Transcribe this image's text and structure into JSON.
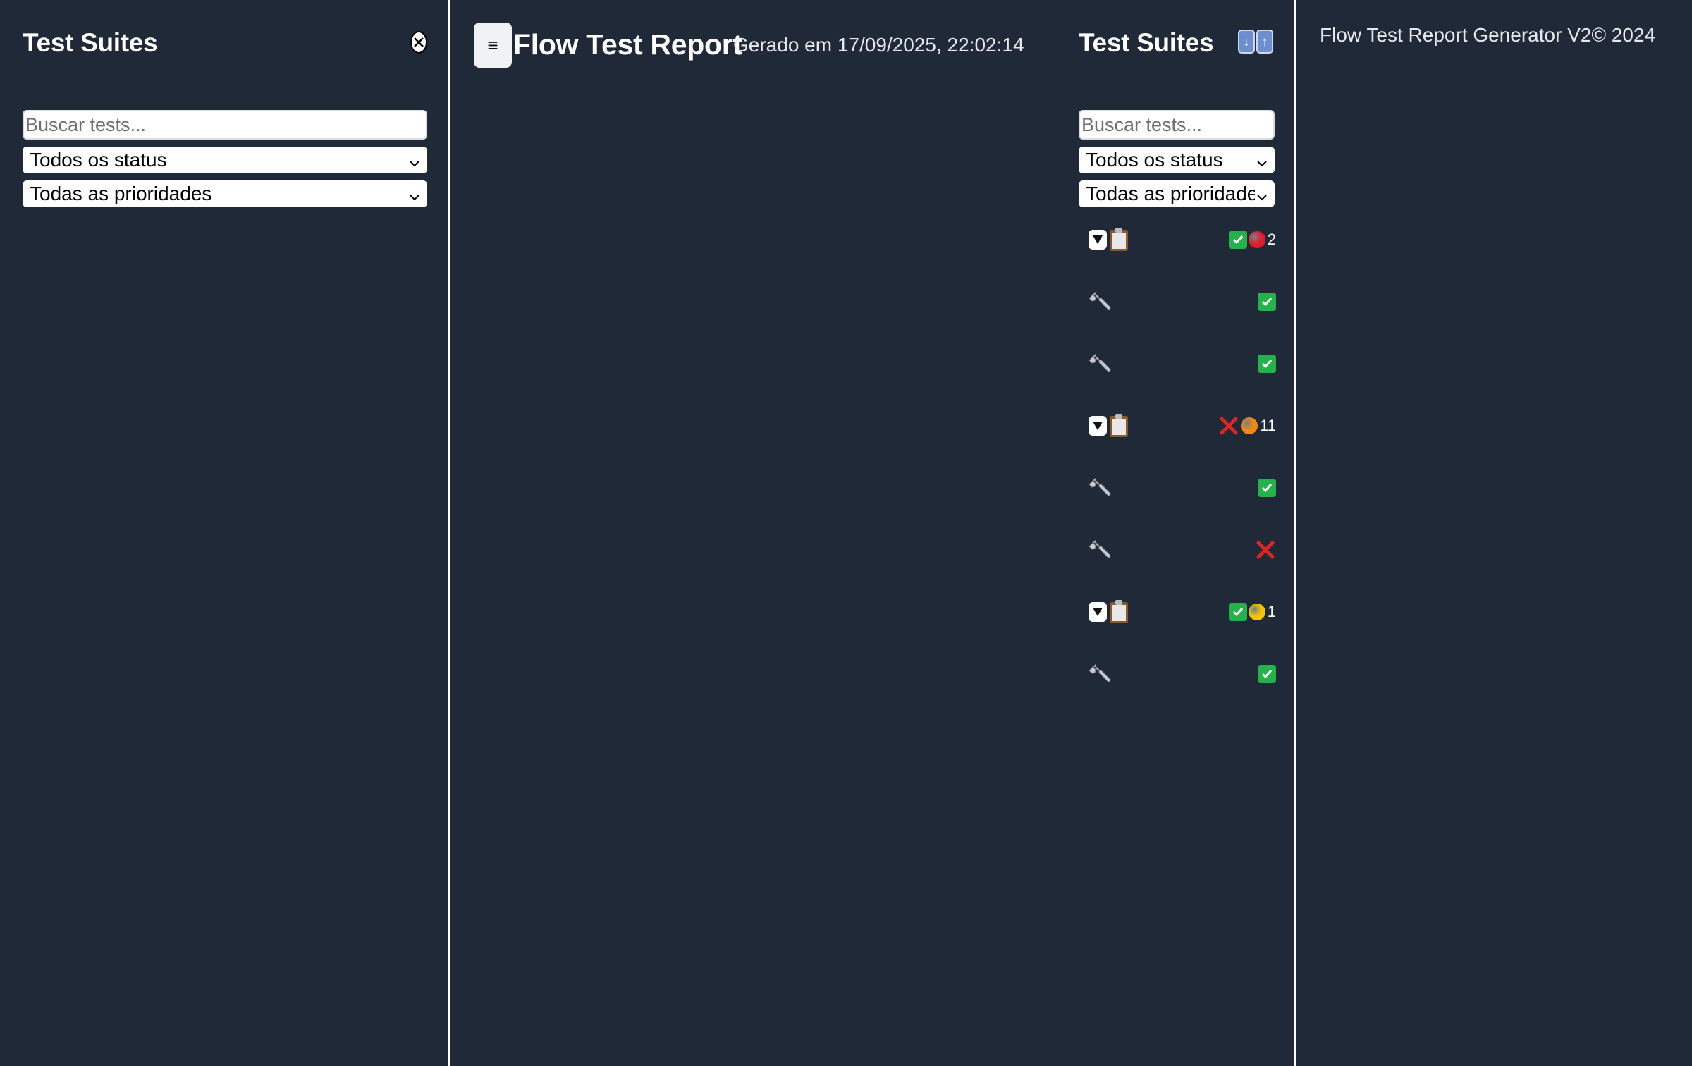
{
  "sidebar": {
    "title": "Test Suites",
    "search_placeholder": "Buscar tests...",
    "status_filter": "Todos os status",
    "priority_filter": "Todas as prioridades"
  },
  "header": {
    "menu_label": "≡",
    "title": "Flow Test Report",
    "generated": "Gerado em 17/09/2025, 22:02:14"
  },
  "suites_panel": {
    "title": "Test Suites",
    "search_placeholder": "Buscar tests...",
    "status_filter": "Todos os status",
    "priority_filter": "Todas as prioridade",
    "items": [
      {
        "kind": "suite",
        "status": "passed",
        "priority": "red",
        "count": "2"
      },
      {
        "kind": "test",
        "status": "passed"
      },
      {
        "kind": "test",
        "status": "passed"
      },
      {
        "kind": "suite",
        "status": "failed",
        "priority": "orange",
        "count": "11"
      },
      {
        "kind": "test",
        "status": "passed"
      },
      {
        "kind": "test",
        "status": "failed"
      },
      {
        "kind": "suite",
        "status": "passed",
        "priority": "yellow",
        "count": "1"
      },
      {
        "kind": "test",
        "status": "passed"
      }
    ]
  },
  "footer": {
    "text": "Flow Test Report Generator V2© 2024"
  },
  "colors": {
    "background": "#202938",
    "passed": "#24b24b",
    "failed": "#e02424",
    "priority_red": "#e11d2a",
    "priority_orange": "#f08a12",
    "priority_yellow": "#f5c400"
  }
}
